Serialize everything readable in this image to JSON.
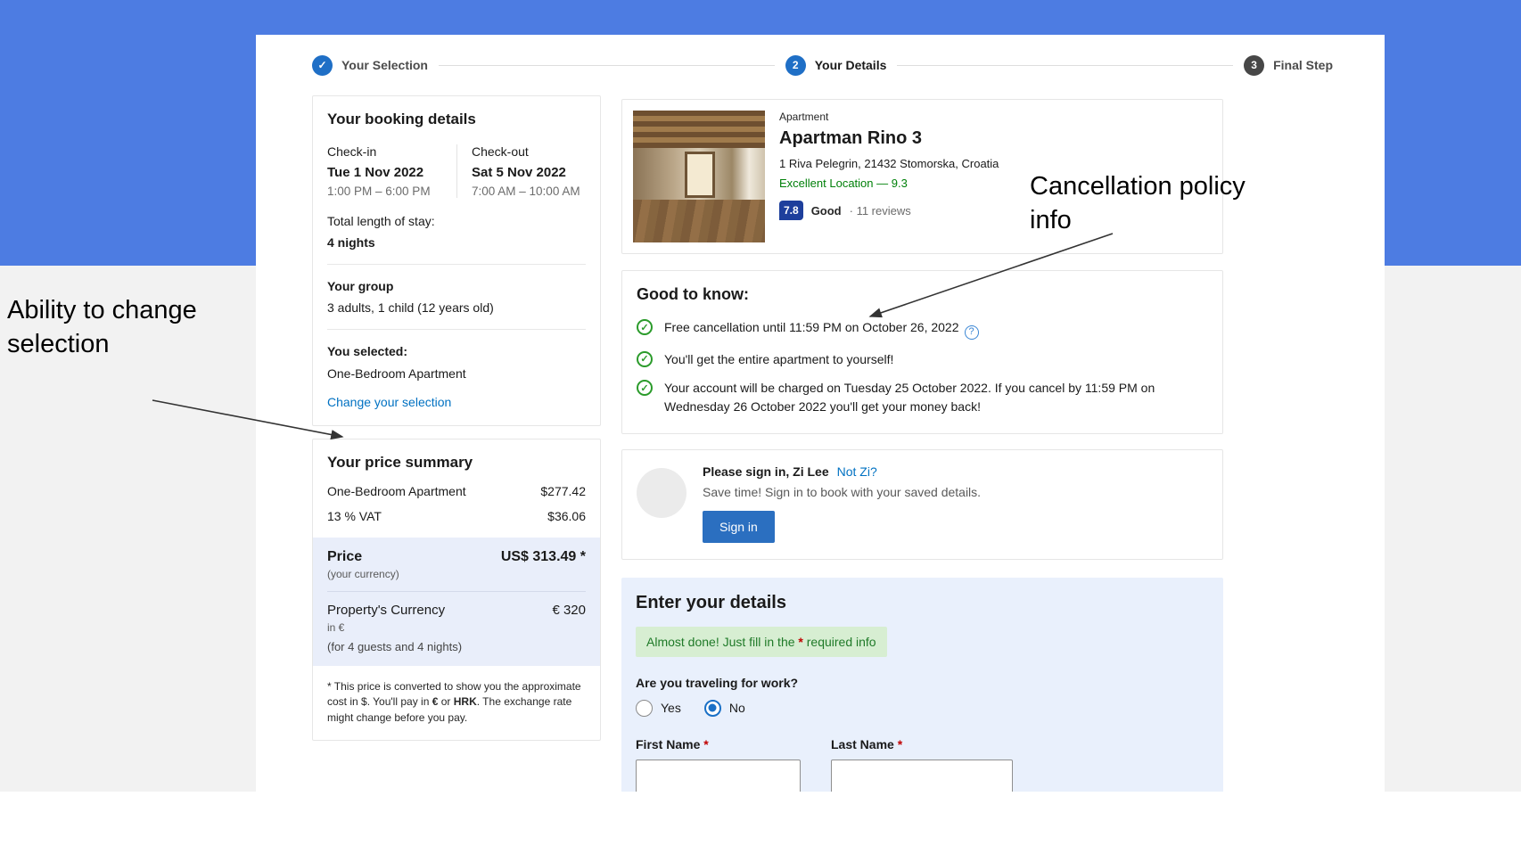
{
  "annotations": {
    "left": "Ability to change selection",
    "right": "Cancellation policy info"
  },
  "stepper": {
    "steps": [
      {
        "label": "Your Selection",
        "state": "done"
      },
      {
        "number": "2",
        "label": "Your Details",
        "state": "current"
      },
      {
        "number": "3",
        "label": "Final Step",
        "state": "upcoming"
      }
    ]
  },
  "booking_details": {
    "title": "Your booking details",
    "checkin_label": "Check-in",
    "checkin_date": "Tue 1 Nov 2022",
    "checkin_time": "1:00 PM – 6:00 PM",
    "checkout_label": "Check-out",
    "checkout_date": "Sat 5 Nov 2022",
    "checkout_time": "7:00 AM – 10:00 AM",
    "stay_label": "Total length of stay:",
    "stay_value": "4 nights",
    "group_label": "Your group",
    "group_value": "3 adults, 1 child (12 years old)",
    "selected_label": "You selected:",
    "selected_value": "One-Bedroom Apartment",
    "change_link": "Change your selection"
  },
  "price_summary": {
    "title": "Your price summary",
    "rows": [
      {
        "label": "One-Bedroom Apartment",
        "value": "$277.42"
      },
      {
        "label": "13 % VAT",
        "value": "$36.06"
      }
    ],
    "price_label": "Price",
    "price_sub": "(your currency)",
    "price_value": "US$ 313.49 *",
    "property_label": "Property's Currency",
    "property_sub1": "in €",
    "property_sub2": "(for 4 guests and 4 nights)",
    "property_value": "€ 320",
    "disclaimer": [
      "* This price is converted to show you the approximate cost in $. You'll pay in ",
      "€",
      " or ",
      "HRK",
      ". The exchange rate might change before you pay."
    ]
  },
  "property": {
    "type": "Apartment",
    "name": "Apartman Rino 3",
    "address": "1 Riva Pelegrin, 21432 Stomorska, Croatia",
    "location_score": "Excellent Location — 9.3",
    "rating_badge": "7.8",
    "rating_word": "Good",
    "rating_count": "· 11 reviews"
  },
  "good_to_know": {
    "title": "Good to know:",
    "items": [
      "Free cancellation until 11:59 PM on October 26, 2022",
      "You'll get the entire apartment to yourself!",
      "Your account will be charged on Tuesday 25 October 2022. If you cancel by 11:59 PM on Wednesday 26 October 2022 you'll get your money back!"
    ]
  },
  "signin": {
    "title": "Please sign in, Zi Lee",
    "not_link": "Not Zi?",
    "subtitle": "Save time! Sign in to book with your saved details.",
    "button": "Sign in"
  },
  "details_form": {
    "title": "Enter your details",
    "alert": [
      "Almost done! Just fill in the ",
      "*",
      " required info"
    ],
    "work_question": "Are you traveling for work?",
    "options": [
      {
        "label": "Yes",
        "selected": false
      },
      {
        "label": "No",
        "selected": true
      }
    ],
    "first_name_label": "First Name",
    "last_name_label": "Last Name",
    "required_mark": "*"
  },
  "colors": {
    "banner_blue": "#4d7ce2",
    "primary_blue": "#1f6fc6",
    "link_blue": "#0071c2",
    "booking_green": "#008009",
    "rating_navy": "#1e3f9c",
    "highlight_blue": "#e9eefa",
    "panel_blue": "#e9f0fc",
    "alert_green_bg": "#d7eed2"
  }
}
